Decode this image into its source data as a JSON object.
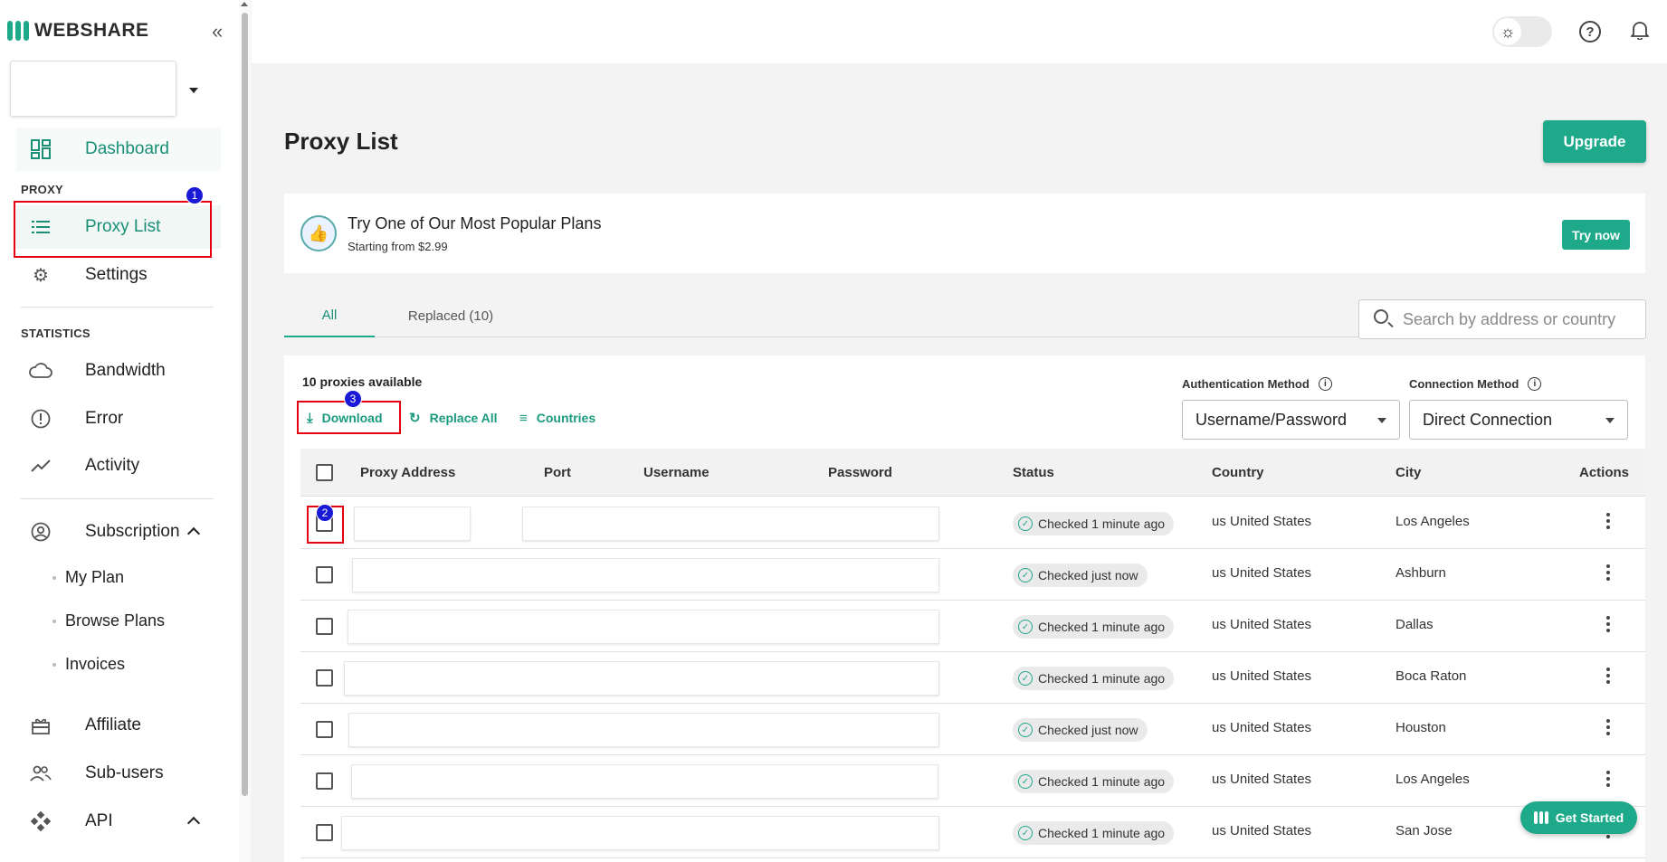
{
  "brand": {
    "name": "WEBSHARE",
    "accent": "#1fa98b"
  },
  "sidebar": {
    "dashboard": "Dashboard",
    "section_proxy": "PROXY",
    "proxy_list": "Proxy List",
    "settings": "Settings",
    "section_statistics": "STATISTICS",
    "bandwidth": "Bandwidth",
    "error": "Error",
    "activity": "Activity",
    "subscription": "Subscription",
    "sub_items": [
      "My Plan",
      "Browse Plans",
      "Invoices"
    ],
    "affiliate": "Affiliate",
    "sub_users": "Sub-users",
    "api": "API"
  },
  "annotations": {
    "badge1": "1",
    "badge2": "2",
    "badge3": "3"
  },
  "header": {
    "title": "Proxy List",
    "upgrade": "Upgrade"
  },
  "promo": {
    "title": "Try One of Our Most Popular Plans",
    "subtitle": "Starting from $2.99",
    "button": "Try now"
  },
  "tabs": [
    {
      "label": "All"
    },
    {
      "label": "Replaced (10)"
    }
  ],
  "search": {
    "placeholder": "Search by address or country"
  },
  "toolbar": {
    "available": "10 proxies available",
    "download": "Download",
    "replace_all": "Replace All",
    "countries": "Countries"
  },
  "auth": {
    "label": "Authentication Method",
    "value": "Username/Password"
  },
  "connection": {
    "label": "Connection Method",
    "value": "Direct Connection"
  },
  "table": {
    "headers": [
      "Proxy Address",
      "Port",
      "Username",
      "Password",
      "Status",
      "Country",
      "City",
      "Actions"
    ],
    "rows": [
      {
        "status": "Checked 1 minute ago",
        "country": "us United States",
        "city": "Los Angeles"
      },
      {
        "status": "Checked just now",
        "country": "us United States",
        "city": "Ashburn"
      },
      {
        "status": "Checked 1 minute ago",
        "country": "us United States",
        "city": "Dallas"
      },
      {
        "status": "Checked 1 minute ago",
        "country": "us United States",
        "city": "Boca Raton"
      },
      {
        "status": "Checked just now",
        "country": "us United States",
        "city": "Houston"
      },
      {
        "status": "Checked 1 minute ago",
        "country": "us United States",
        "city": "Los Angeles"
      },
      {
        "status": "Checked 1 minute ago",
        "country": "us United States",
        "city": "San Jose"
      }
    ]
  },
  "help": {
    "get_started": "Get Started"
  }
}
